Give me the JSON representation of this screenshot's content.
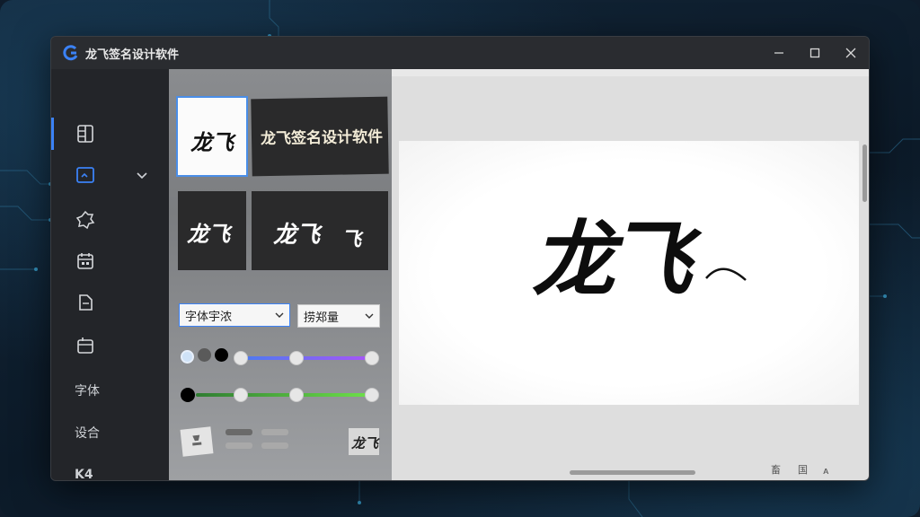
{
  "app": {
    "title": "龙飞签名设计软件"
  },
  "sidebar": {
    "items": [
      {
        "name": "layout-icon"
      },
      {
        "name": "image-edit-icon"
      },
      {
        "name": "badge-icon"
      },
      {
        "name": "calendar-icon"
      },
      {
        "name": "document-icon"
      },
      {
        "name": "board-icon"
      },
      {
        "label": "字体"
      },
      {
        "label": "设合"
      },
      {
        "label": "K4"
      }
    ]
  },
  "templates": {
    "items": [
      {
        "text": "龙飞",
        "style": "white"
      },
      {
        "text": "龙飞签名设计软件",
        "style": "black-wide"
      },
      {
        "text": "龙飞",
        "style": "black"
      },
      {
        "text": "龙飞",
        "text2": "飞",
        "style": "black-wide"
      }
    ]
  },
  "controls": {
    "font_dropdown": "字体宇浓",
    "style_dropdown": "捞郑量",
    "preview_thumb_text": "龙飞"
  },
  "colors": {
    "accent": "#3b82f6",
    "slider1_gradient": [
      "#4a7cf0",
      "#a855f7"
    ],
    "slider2_gradient": [
      "#2f7d32",
      "#6ee04a"
    ],
    "swatches": [
      "#cfe2f7",
      "#5a5a5a",
      "#000000"
    ]
  },
  "canvas": {
    "signature_text": "龙飞"
  },
  "status": {
    "glyphs": [
      "畜",
      "国",
      "ᴀ"
    ]
  }
}
